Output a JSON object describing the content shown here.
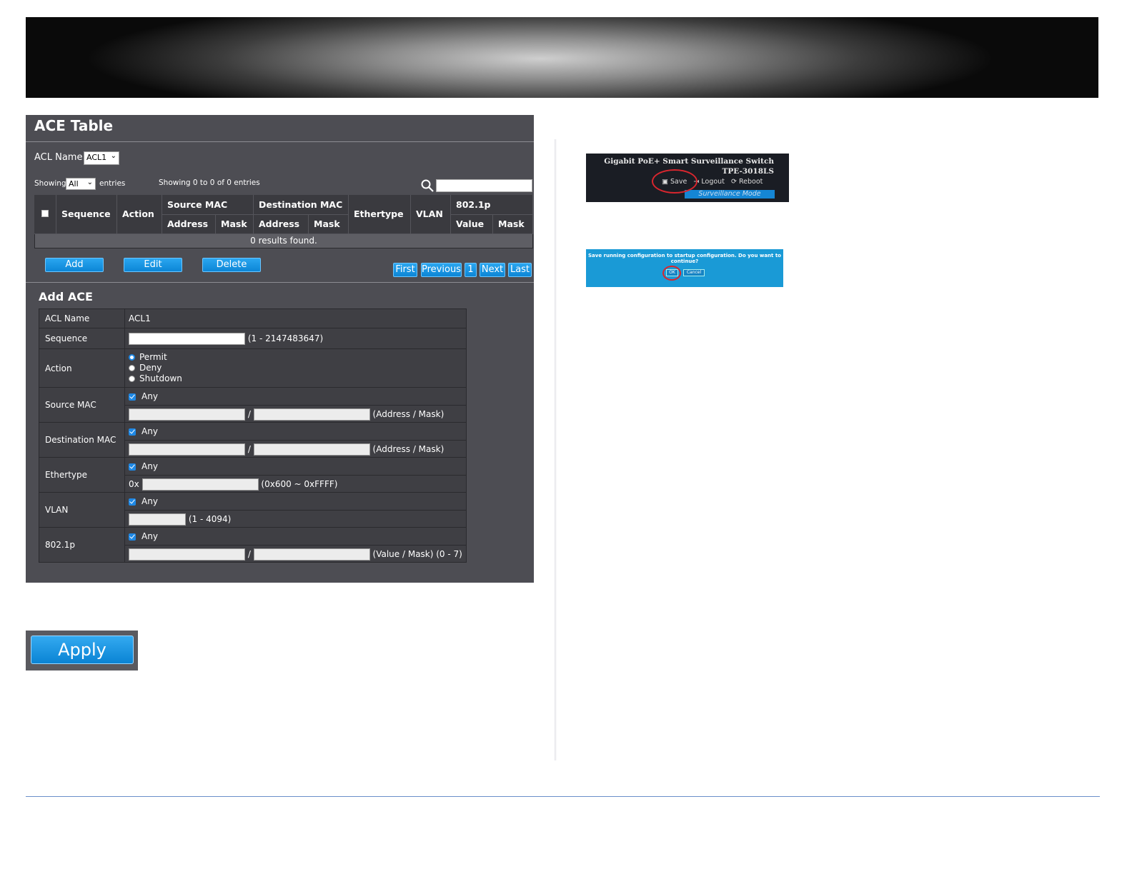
{
  "ace_table": {
    "title": "ACE Table",
    "acl_name_label": "ACL Name",
    "acl_name_value": "ACL1",
    "showing_label": "Showing",
    "showing_value": "All",
    "entries_label": "entries",
    "summary": "Showing 0 to 0 of 0 entries",
    "columns": {
      "sequence": "Sequence",
      "action": "Action",
      "source_mac": "Source MAC",
      "destination_mac": "Destination MAC",
      "ethertype": "Ethertype",
      "vlan": "VLAN",
      "dot1p": "802.1p",
      "address": "Address",
      "mask": "Mask",
      "value": "Value"
    },
    "empty_text": "0 results found.",
    "buttons": {
      "add": "Add",
      "edit": "Edit",
      "delete": "Delete"
    },
    "pagination": {
      "first": "First",
      "previous": "Previous",
      "page": "1",
      "next": "Next",
      "last": "Last"
    }
  },
  "add_ace": {
    "title": "Add ACE",
    "acl_name_label": "ACL Name",
    "acl_name_value": "ACL1",
    "sequence_label": "Sequence",
    "sequence_hint": "(1 - 2147483647)",
    "action_label": "Action",
    "action_options": [
      "Permit",
      "Deny",
      "Shutdown"
    ],
    "action_selected": "Permit",
    "source_mac_label": "Source MAC",
    "destination_mac_label": "Destination MAC",
    "ethertype_label": "Ethertype",
    "vlan_label": "VLAN",
    "dot1p_label": "802.1p",
    "any_label": "Any",
    "slash": "/",
    "address_mask_hint": "(Address / Mask)",
    "ethertype_prefix": "0x",
    "ethertype_hint": "(0x600 ~ 0xFFFF)",
    "vlan_hint": "(1 - 4094)",
    "dot1p_hint": "(Value / Mask) (0 - 7)"
  },
  "apply_label": "Apply",
  "header_screenshot": {
    "product": "Gigabit PoE+ Smart Surveillance Switch",
    "model": "TPE-3018LS",
    "save": "Save",
    "logout": "Logout",
    "reboot": "Reboot",
    "mode": "Surveillance Mode"
  },
  "dialog_screenshot": {
    "message": "Save running configuration to startup configuration. Do you want to continue?",
    "ok": "OK",
    "cancel": "Cancel"
  },
  "colors": {
    "accent": "#0c86d6",
    "panel": "#4d4d53",
    "highlight_ring": "#d8262e"
  }
}
